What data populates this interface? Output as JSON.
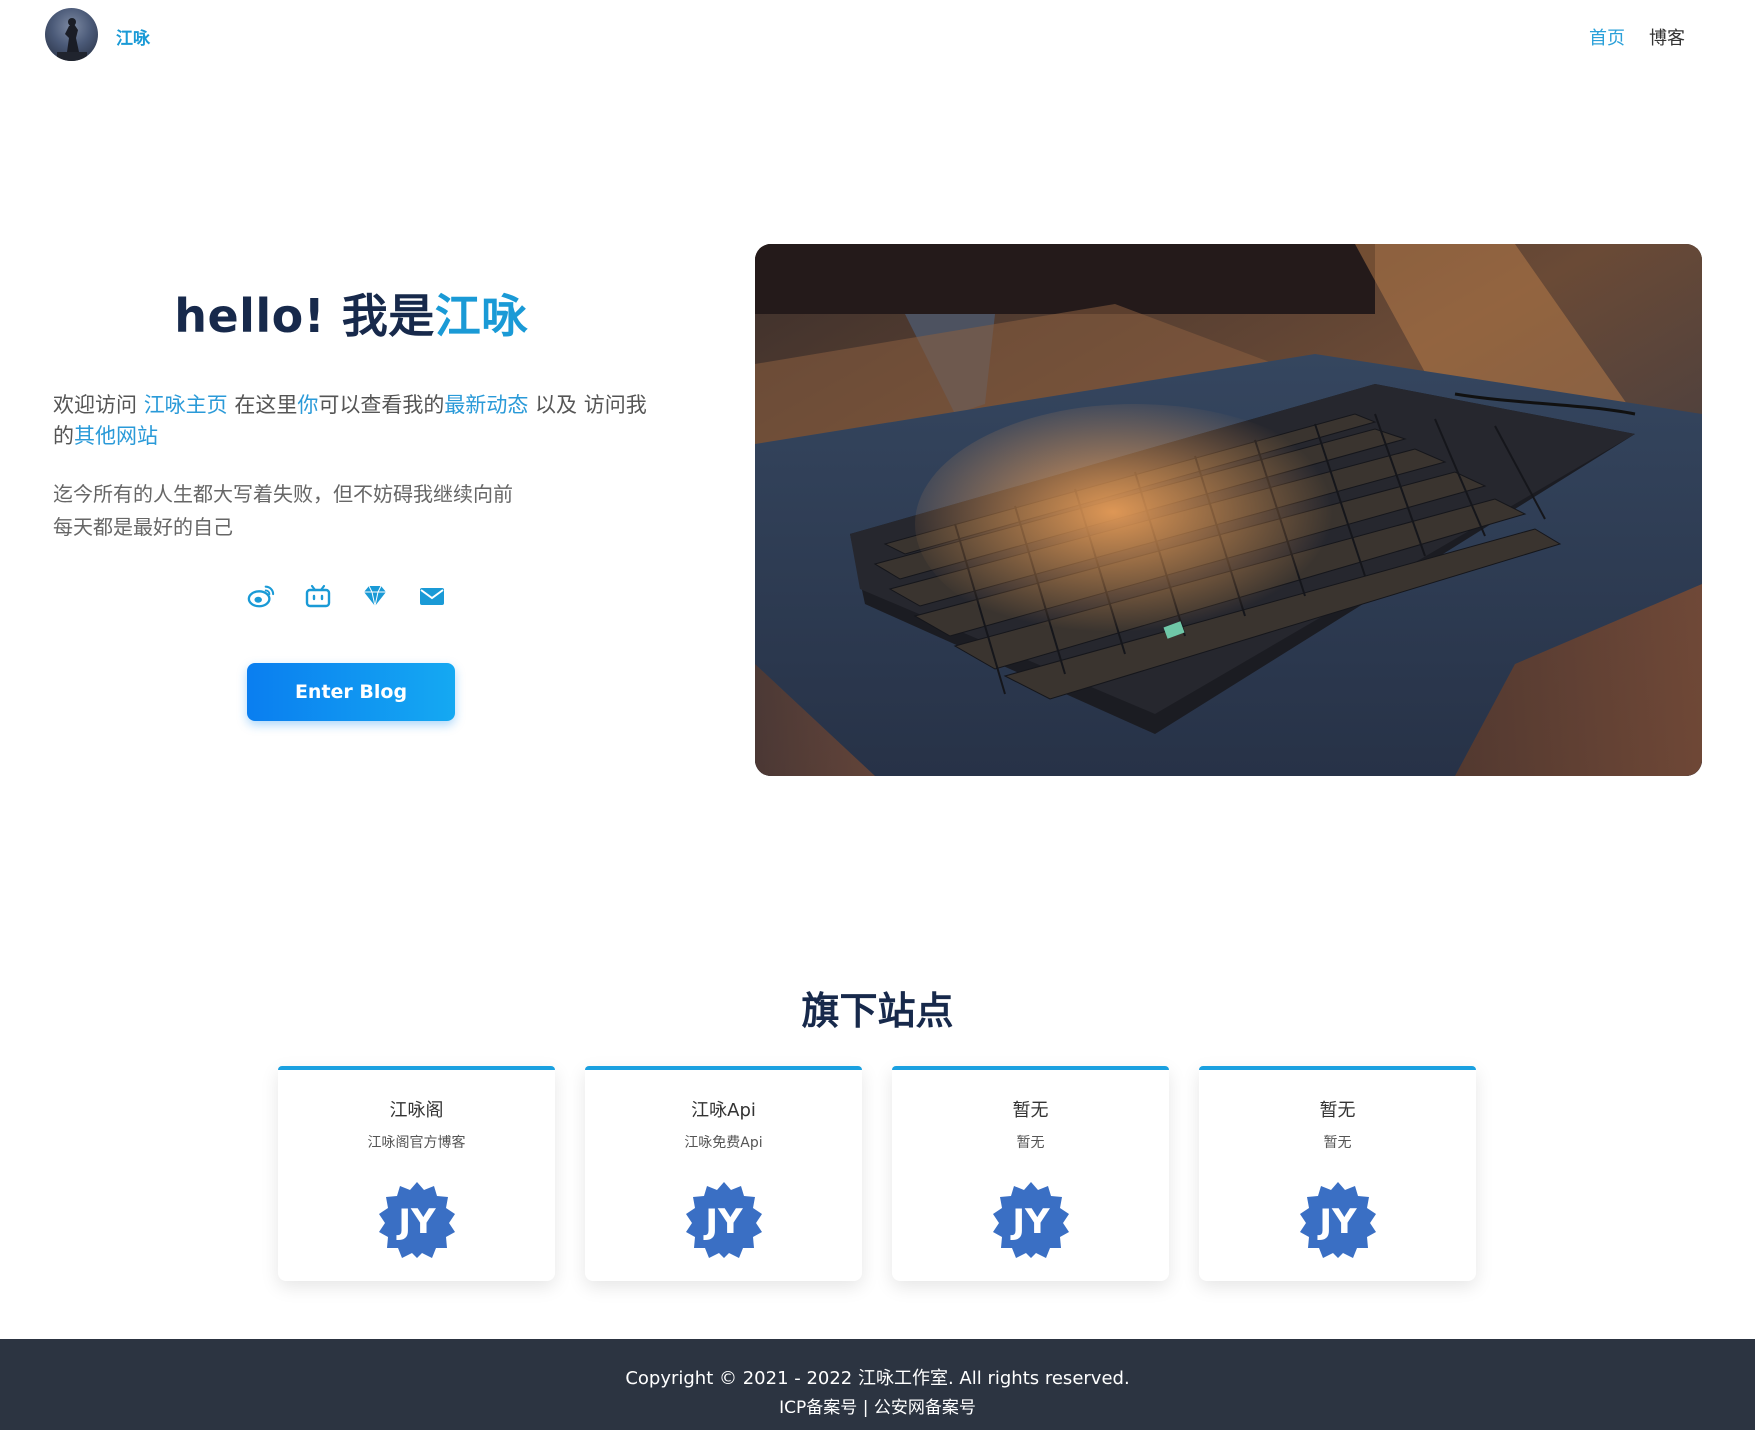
{
  "header": {
    "brand": "江咏",
    "nav": [
      {
        "label": "首页",
        "active": true
      },
      {
        "label": "博客",
        "active": false
      }
    ]
  },
  "hero": {
    "title_prefix": "hello! 我是",
    "title_name": "江咏",
    "intro": {
      "t1": "欢迎访问 ",
      "link1": "江咏主页",
      "t2": " 在这里",
      "link2": "你",
      "t3": "可以查看我的",
      "link3": "最新动态",
      "t4": " 以及 访问我的",
      "link4": "其他网站"
    },
    "motto": [
      "迄今所有的人生都大写着失败，但不妨碍我继续向前",
      "每天都是最好的自己"
    ],
    "socials": [
      "weibo-icon",
      "bilibili-icon",
      "diamond-icon",
      "mail-icon"
    ],
    "button_label": "Enter Blog"
  },
  "sites": {
    "title": "旗下站点",
    "cards": [
      {
        "title": "江咏阁",
        "subtitle": "江咏阁官方博客",
        "logo": "JY"
      },
      {
        "title": "江咏Api",
        "subtitle": "江咏免费Api",
        "logo": "JY"
      },
      {
        "title": "暂无",
        "subtitle": "暂无",
        "logo": "JY"
      },
      {
        "title": "暂无",
        "subtitle": "暂无",
        "logo": "JY"
      }
    ]
  },
  "footer": {
    "copyright": "Copyright © 2021 - 2022 江咏工作室. All rights reserved.",
    "icp": "ICP备案号",
    "separator": " | ",
    "police": "公安网备案号"
  },
  "colors": {
    "accent": "#1a9ad6",
    "heading": "#17294b",
    "button": "#0a7ef0",
    "footer_bg": "#2c3441",
    "logo_blue": "#3a6fc4"
  }
}
